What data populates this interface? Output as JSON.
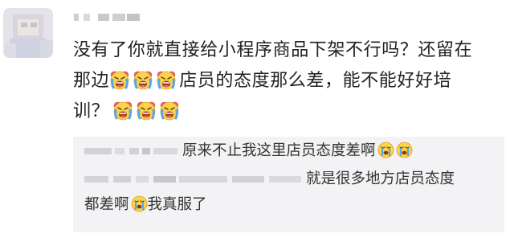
{
  "comment": {
    "avatar": "blurred-avatar",
    "username": "",
    "line1": "没有了你就直接给小程序商品下架不行吗？还留在",
    "line2_prefix": "那边",
    "line2_suffix": "店员的态度那么差，能不能好好培",
    "line3_prefix": "训？",
    "emoji_icon": "crying-emoji-icon"
  },
  "replies": [
    {
      "username": "",
      "text": "原来不止我这里店员态度差啊",
      "emoji_icon": "sob-emoji-icon"
    },
    {
      "username": "",
      "text_a": "就是很多地方店员态度",
      "text_b": "都差啊",
      "text_c": "我真服了",
      "emoji_icon": "sob-emoji-icon"
    }
  ],
  "colors": {
    "text": "#222222",
    "reply_bg": "#f3f3f5",
    "emoji_yellow": "#fcd34d",
    "tear_blue": "#5aa5e6"
  }
}
